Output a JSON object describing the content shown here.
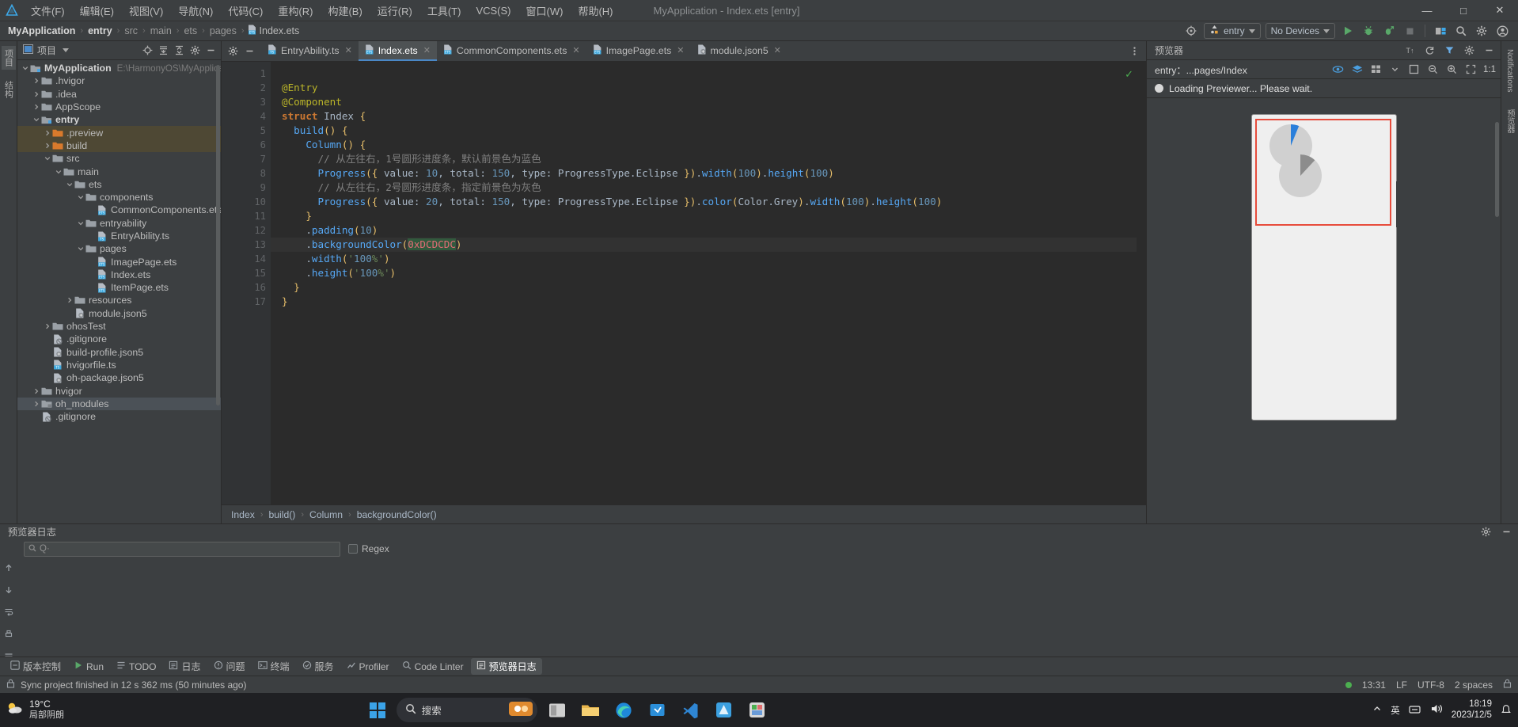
{
  "titlebar": {
    "menu": [
      "文件(F)",
      "编辑(E)",
      "视图(V)",
      "导航(N)",
      "代码(C)",
      "重构(R)",
      "构建(B)",
      "运行(R)",
      "工具(T)",
      "VCS(S)",
      "窗口(W)",
      "帮助(H)"
    ],
    "window_title": "MyApplication - Index.ets [entry]",
    "minimize": "—",
    "maximize": "□",
    "close": "✕"
  },
  "navbar": {
    "crumbs": [
      "MyApplication",
      "entry",
      "src",
      "main",
      "ets",
      "pages",
      "Index.ets"
    ],
    "separator": "›",
    "target_selector": "entry",
    "device_selector": "No Devices",
    "icons": {
      "settings_target": "target-icon",
      "run": "run-icon",
      "debug": "debug-icon",
      "attach_debug": "attach-debugger-icon",
      "stop": "stop-icon",
      "device_manager": "device-manager-icon",
      "search_everywhere": "search-icon",
      "settings": "gear-icon",
      "account": "account-icon"
    }
  },
  "left_strip": {
    "tabs": [
      "项目",
      "结构"
    ]
  },
  "project_panel": {
    "title": "项目",
    "tools": [
      "locate-icon",
      "expand-all-icon",
      "collapse-all-icon",
      "gear-icon",
      "hide-icon"
    ],
    "tree": [
      {
        "depth": 0,
        "arrow": "down",
        "icon": "project-root",
        "label": "MyApplication",
        "bold": true,
        "path": "E:\\HarmonyOS\\MyApplicatio"
      },
      {
        "depth": 1,
        "arrow": "right",
        "icon": "folder",
        "label": ".hvigor"
      },
      {
        "depth": 1,
        "arrow": "right",
        "icon": "folder",
        "label": ".idea"
      },
      {
        "depth": 1,
        "arrow": "right",
        "icon": "folder",
        "label": "AppScope"
      },
      {
        "depth": 1,
        "arrow": "down",
        "icon": "module",
        "label": "entry",
        "bold": true
      },
      {
        "depth": 2,
        "arrow": "right",
        "icon": "folder-orange",
        "label": ".preview",
        "highlight": true
      },
      {
        "depth": 2,
        "arrow": "right",
        "icon": "folder-orange",
        "label": "build",
        "highlight": true
      },
      {
        "depth": 2,
        "arrow": "down",
        "icon": "folder",
        "label": "src"
      },
      {
        "depth": 3,
        "arrow": "down",
        "icon": "folder",
        "label": "main"
      },
      {
        "depth": 4,
        "arrow": "down",
        "icon": "folder",
        "label": "ets"
      },
      {
        "depth": 5,
        "arrow": "down",
        "icon": "folder",
        "label": "components"
      },
      {
        "depth": 6,
        "arrow": "none",
        "icon": "ets-file",
        "label": "CommonComponents.ets"
      },
      {
        "depth": 5,
        "arrow": "down",
        "icon": "folder",
        "label": "entryability"
      },
      {
        "depth": 6,
        "arrow": "none",
        "icon": "ts-file",
        "label": "EntryAbility.ts"
      },
      {
        "depth": 5,
        "arrow": "down",
        "icon": "folder",
        "label": "pages"
      },
      {
        "depth": 6,
        "arrow": "none",
        "icon": "ets-file",
        "label": "ImagePage.ets"
      },
      {
        "depth": 6,
        "arrow": "none",
        "icon": "ets-file",
        "label": "Index.ets"
      },
      {
        "depth": 6,
        "arrow": "none",
        "icon": "ets-file",
        "label": "ItemPage.ets"
      },
      {
        "depth": 4,
        "arrow": "right",
        "icon": "folder",
        "label": "resources"
      },
      {
        "depth": 4,
        "arrow": "none",
        "icon": "json-file",
        "label": "module.json5"
      },
      {
        "depth": 2,
        "arrow": "right",
        "icon": "folder",
        "label": "ohosTest"
      },
      {
        "depth": 2,
        "arrow": "none",
        "icon": "gitignore-file",
        "label": ".gitignore"
      },
      {
        "depth": 2,
        "arrow": "none",
        "icon": "json-file",
        "label": "build-profile.json5"
      },
      {
        "depth": 2,
        "arrow": "none",
        "icon": "ts-file",
        "label": "hvigorfile.ts"
      },
      {
        "depth": 2,
        "arrow": "none",
        "icon": "json-file",
        "label": "oh-package.json5"
      },
      {
        "depth": 1,
        "arrow": "right",
        "icon": "folder",
        "label": "hvigor"
      },
      {
        "depth": 1,
        "arrow": "right",
        "icon": "folder-lib",
        "label": "oh_modules",
        "selected": true
      },
      {
        "depth": 1,
        "arrow": "none",
        "icon": "gitignore-file",
        "label": ".gitignore"
      }
    ]
  },
  "editor": {
    "tabs": [
      {
        "label": "EntryAbility.ts",
        "icon": "ts-file",
        "active": false
      },
      {
        "label": "Index.ets",
        "icon": "ets-file",
        "active": true
      },
      {
        "label": "CommonComponents.ets",
        "icon": "ets-file",
        "active": false
      },
      {
        "label": "ImagePage.ets",
        "icon": "ets-file",
        "active": false
      },
      {
        "label": "module.json5",
        "icon": "json-file",
        "active": false
      }
    ],
    "close_glyph": "✕",
    "lines": [
      {
        "n": 1,
        "text": ""
      },
      {
        "n": 2,
        "text": "@Entry"
      },
      {
        "n": 3,
        "text": "@Component"
      },
      {
        "n": 4,
        "text": "struct Index {",
        "fold": true
      },
      {
        "n": 5,
        "text": "  build() {",
        "fold": true
      },
      {
        "n": 6,
        "text": "    Column() {",
        "fold": true
      },
      {
        "n": 7,
        "text": "      // 从左往右，1号圆形进度条，默认前景色为蓝色"
      },
      {
        "n": 8,
        "text": "      Progress({ value: 10, total: 150, type: ProgressType.Eclipse }).width(100).height(100)"
      },
      {
        "n": 9,
        "text": "      // 从左往右，2号圆形进度条，指定前景色为灰色"
      },
      {
        "n": 10,
        "text": "      Progress({ value: 20, total: 150, type: ProgressType.Eclipse }).color(Color.Grey).width(100).height(100)"
      },
      {
        "n": 11,
        "text": "    }",
        "fold": true
      },
      {
        "n": 12,
        "text": "    .padding(10)"
      },
      {
        "n": 13,
        "text": "    .backgroundColor(0xDCDCDC)",
        "bulb": true,
        "current": true
      },
      {
        "n": 14,
        "text": "    .width('100%')"
      },
      {
        "n": 15,
        "text": "    .height('100%')"
      },
      {
        "n": 16,
        "text": "  }",
        "fold": true
      },
      {
        "n": 17,
        "text": "}",
        "fold": true
      }
    ],
    "breadcrumb": [
      "Index",
      "build()",
      "Column",
      "backgroundColor()"
    ],
    "breadcrumb_separator": "›",
    "inspection_ok": "✓"
  },
  "previewer": {
    "title": "预览器",
    "target": "entry：...pages/Index",
    "status_text": "Loading Previewer... Please wait.",
    "toolbar_icons": [
      "eye-icon",
      "layers-icon",
      "grid-icon",
      "dropdown-icon",
      "frame-icon",
      "zoom-out-icon",
      "zoom-in-icon",
      "fit-icon"
    ],
    "zoom_level": "1:1",
    "head_icons": [
      "translate-icon",
      "refresh-icon",
      "filter-icon",
      "gear-icon",
      "hide-icon"
    ]
  },
  "right_strip": {
    "tabs": [
      "Notifications",
      "预览器"
    ]
  },
  "log_panel": {
    "title": "预览器日志",
    "search_placeholder": "Q·",
    "regex_label": "Regex",
    "tools": [
      "gear-icon",
      "hide-icon"
    ]
  },
  "tool_windows": {
    "items": [
      {
        "label": "版本控制",
        "icon": "vcs-icon",
        "active": false
      },
      {
        "label": "Run",
        "icon": "run-icon",
        "active": false
      },
      {
        "label": "TODO",
        "icon": "todo-icon",
        "active": false
      },
      {
        "label": "日志",
        "icon": "log-icon",
        "active": false
      },
      {
        "label": "问题",
        "icon": "problems-icon",
        "active": false
      },
      {
        "label": "终端",
        "icon": "terminal-icon",
        "active": false
      },
      {
        "label": "服务",
        "icon": "services-icon",
        "active": false
      },
      {
        "label": "Profiler",
        "icon": "profiler-icon",
        "active": false
      },
      {
        "label": "Code Linter",
        "icon": "linter-icon",
        "active": false
      },
      {
        "label": "预览器日志",
        "icon": "previewer-log-icon",
        "active": true
      }
    ]
  },
  "statusbar": {
    "message": "Sync project finished in 12 s 362 ms (50 minutes ago)",
    "time": "13:31",
    "line_sep": "LF",
    "encoding": "UTF-8",
    "indent": "2 spaces",
    "lock_icon": "lock-icon"
  },
  "taskbar": {
    "weather_temp": "19°C",
    "weather_desc": "局部阴朗",
    "search_placeholder": "搜索",
    "clock_time": "18:19",
    "clock_date": "2023/12/5",
    "ime": "英",
    "apps": [
      "start-icon",
      "file-explorer-icon",
      "folder-icon",
      "edge-icon",
      "store-icon",
      "vscode-icon",
      "deveco-icon",
      "app-icon"
    ]
  },
  "colors": {
    "accent_blue": "#4a88c7",
    "highlight_orange": "#4e4834",
    "run_green": "#4caf50",
    "red_frame": "#e74c3c",
    "preview_bg": "#efefef",
    "progress_blue": "#2a7fdb",
    "progress_grey": "#8c8c8c"
  }
}
